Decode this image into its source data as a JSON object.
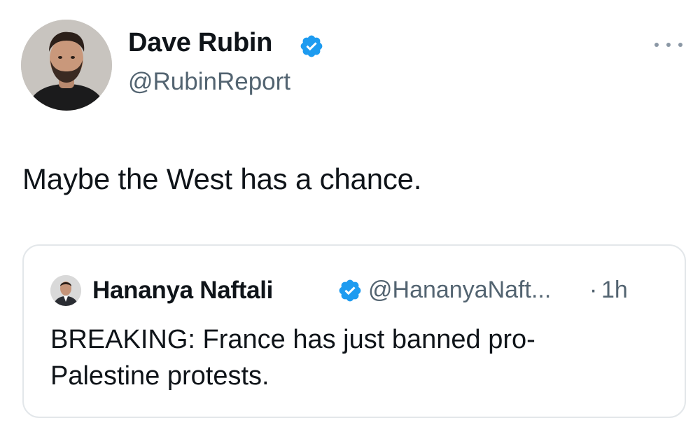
{
  "tweet": {
    "author": {
      "name": "Dave Rubin",
      "handle": "@RubinReport",
      "verified": true,
      "avatar_icon": "profile-photo"
    },
    "more_icon": "ellipsis-icon",
    "text": "Maybe the West has a chance.",
    "quoted_tweet": {
      "author": {
        "name": "Hananya Naftali",
        "handle": "@HananyaNaft...",
        "verified": true,
        "avatar_icon": "profile-photo"
      },
      "separator": "·",
      "time": "1h",
      "text": "BREAKING: France has just banned pro-Palestine protests."
    }
  },
  "colors": {
    "text_primary": "#0f1419",
    "text_secondary": "#536471",
    "verified_blue": "#1d9bf0",
    "border": "#e3e7ea",
    "background": "#ffffff"
  }
}
